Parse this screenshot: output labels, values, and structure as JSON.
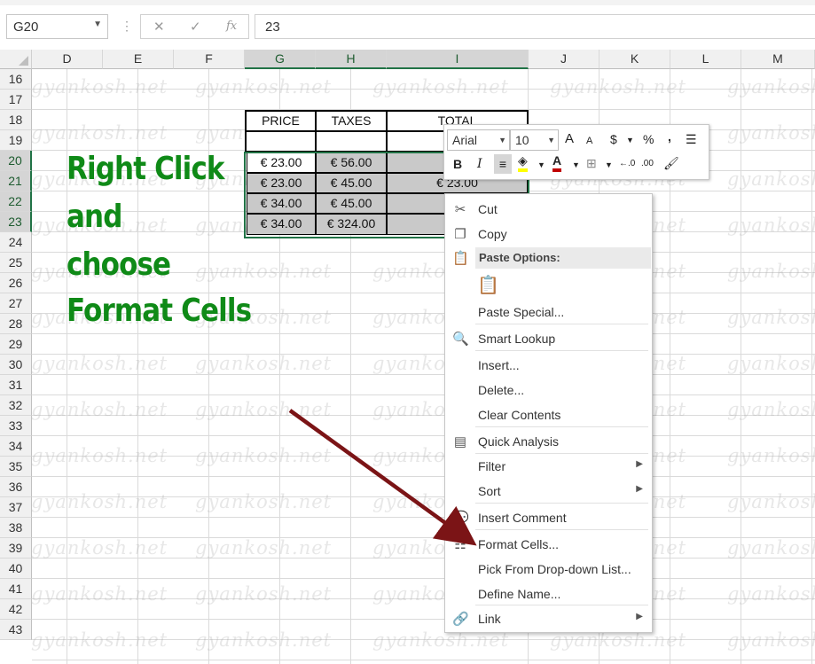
{
  "formula_bar": {
    "name_box": "G20",
    "formula_value": "23",
    "cancel_glyph": "✕",
    "enter_glyph": "✓",
    "fx_glyph": "fx"
  },
  "columns": [
    "D",
    "E",
    "F",
    "G",
    "H",
    "I",
    "J",
    "K",
    "L",
    "M"
  ],
  "rows": [
    "16",
    "17",
    "18",
    "19",
    "20",
    "21",
    "22",
    "23",
    "24",
    "25",
    "26",
    "27",
    "28",
    "29",
    "30",
    "31",
    "32",
    "33",
    "34",
    "35",
    "36",
    "37",
    "38",
    "39",
    "40",
    "41",
    "42",
    "43"
  ],
  "watermark": "gyankosh.net",
  "table": {
    "headers": [
      "PRICE",
      "TAXES",
      "TOTAL"
    ],
    "rows": [
      [
        "€ 23.00",
        "€ 56.00",
        "€"
      ],
      [
        "€ 23.00",
        "€ 45.00",
        "€ 23.00"
      ],
      [
        "€ 34.00",
        "€ 45.00",
        "€"
      ],
      [
        "€ 34.00",
        "€ 324.00",
        "€"
      ]
    ]
  },
  "annotation": {
    "line1": "Right Click",
    "line2": "and",
    "line3": "choose",
    "line4": "Format Cells",
    "color": "#0f8a17"
  },
  "arrow_color": "#7b1416",
  "mini_toolbar": {
    "font": "Arial",
    "size": "10",
    "grow_font": "A",
    "shrink_font": "A",
    "currency": "$",
    "percent": "%",
    "comma": ",",
    "bold": "B",
    "italic": "I",
    "font_color": "A",
    "increase_decimal": "←.0",
    "decrease_decimal": ".00"
  },
  "context_menu": {
    "cut": "Cut",
    "copy": "Copy",
    "paste_options": "Paste Options:",
    "paste_special": "Paste Special...",
    "smart_lookup": "Smart Lookup",
    "insert": "Insert...",
    "delete": "Delete...",
    "clear_contents": "Clear Contents",
    "quick_analysis": "Quick Analysis",
    "filter": "Filter",
    "sort": "Sort",
    "insert_comment": "Insert Comment",
    "format_cells": "Format Cells...",
    "pick_from_list": "Pick From Drop-down List...",
    "define_name": "Define Name...",
    "link": "Link"
  },
  "selection_color": "#217346"
}
